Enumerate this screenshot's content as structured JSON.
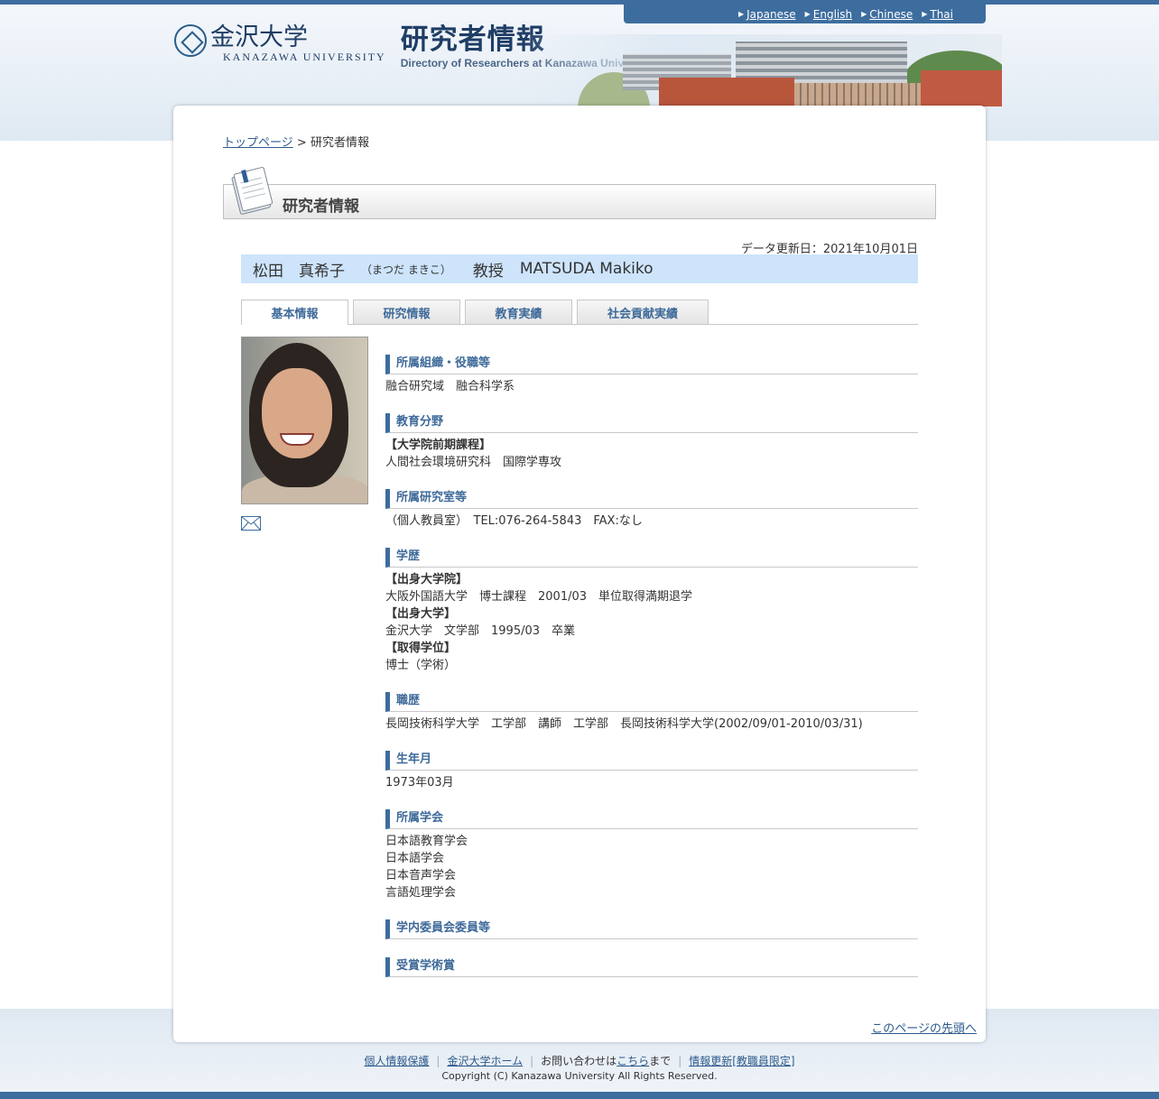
{
  "lang_bar": {
    "items": [
      "Japanese",
      "English",
      "Chinese",
      "Thai"
    ]
  },
  "logo": {
    "university_ja": "金沢大学",
    "university_en": "KANAZAWA UNIVERSITY",
    "site_title_ja": "研究者情報",
    "site_title_en": "Directory of Researchers at Kanazawa University"
  },
  "breadcrumb": {
    "home": "トップページ",
    "separator": ">",
    "current": "研究者情報"
  },
  "page_heading": "研究者情報",
  "updated": "データ更新日：2021年10月01日",
  "researcher": {
    "name": "松田　真希子",
    "kana": "（まつだ まきこ）",
    "title": "教授",
    "name_en": "MATSUDA Makiko"
  },
  "tabs": [
    "基本情報",
    "研究情報",
    "教育実績",
    "社会貢献実績"
  ],
  "sections": {
    "affiliation": {
      "heading": "所属組織・役職等",
      "lines": [
        "融合研究域　融合科学系"
      ]
    },
    "education_field": {
      "heading": "教育分野",
      "label": "【大学院前期課程】",
      "lines": [
        "人間社会環境研究科　国際学専攻"
      ]
    },
    "lab": {
      "heading": "所属研究室等",
      "lines": [
        "（個人教員室）　TEL:076-264-5843　FAX:なし"
      ]
    },
    "background": {
      "heading": "学歴",
      "grad_label": "【出身大学院】",
      "grad": "大阪外国語大学　博士課程　2001/03　単位取得満期退学",
      "univ_label": "【出身大学】",
      "univ": "金沢大学　文学部　1995/03　卒業",
      "degree_label": "【取得学位】",
      "degree": "博士（学術）"
    },
    "career": {
      "heading": "職歴",
      "lines": [
        "長岡技術科学大学　工学部　講師　工学部　長岡技術科学大学(2002/09/01-2010/03/31)"
      ]
    },
    "birth": {
      "heading": "生年月",
      "lines": [
        "1973年03月"
      ]
    },
    "societies": {
      "heading": "所属学会",
      "lines": [
        "日本語教育学会",
        "日本語学会",
        "日本音声学会",
        "言語処理学会"
      ]
    },
    "committees": {
      "heading": "学内委員会委員等"
    },
    "awards": {
      "heading": "受賞学術賞"
    }
  },
  "pagetop": "このページの先頭へ",
  "footer": {
    "privacy": "個人情報保護",
    "home": "金沢大学ホーム",
    "contact_prefix": "お問い合わせは",
    "contact_link": "こちら",
    "contact_suffix": "まで",
    "update": "情報更新[教職員限定]",
    "copyright": "Copyright (C) Kanazawa University All Rights Reserved."
  }
}
